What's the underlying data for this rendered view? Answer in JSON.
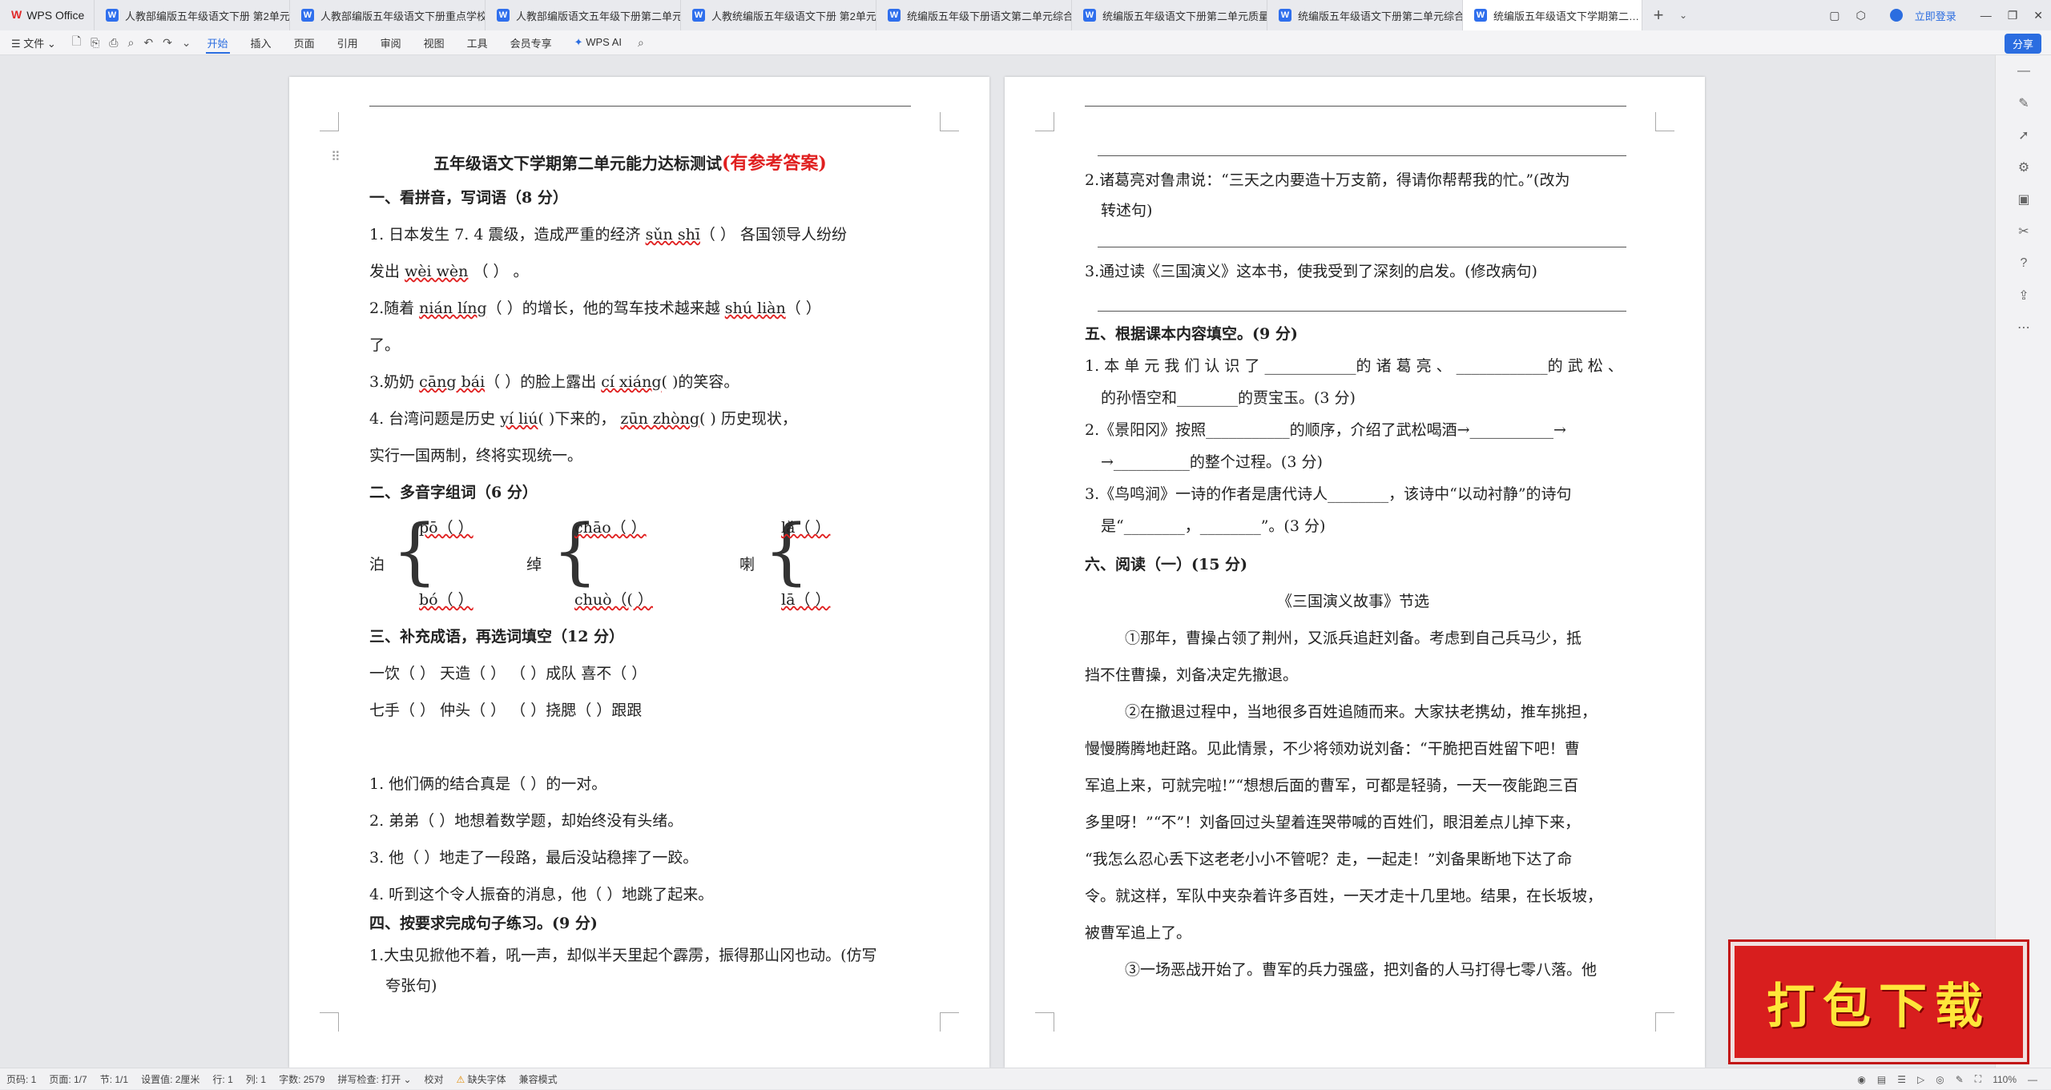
{
  "tabs": {
    "wps": "WPS Office",
    "docs": [
      "人教部编版五年级语文下册 第2单元…",
      "人教部编版五年级语文下册重点学校…",
      "人教部编版语文五年级下册第二单元…",
      "人教统编版五年级语文下册 第2单元…",
      "统编版五年级下册语文第二单元综合…",
      "统编版五年级语文下册第二单元质量…",
      "统编版五年级语文下册第二单元综合…"
    ],
    "active": "统编版五年级语文下学期第二…",
    "login": "立即登录"
  },
  "menu": {
    "file": "文件",
    "items": [
      "开始",
      "插入",
      "页面",
      "引用",
      "审阅",
      "视图",
      "工具",
      "会员专享"
    ],
    "ai": "WPS AI",
    "share": "分享"
  },
  "left": {
    "title": "五年级语文下学期第二单元能力达标测试",
    "title_red": "(有参考答案)",
    "s1": "一、看拼音，写词语（8 分）",
    "l1a": "1. 日本发生 7. 4 震级，造成严重的经济",
    "p_sunshi": "sǔn shī",
    "l1b": "（        ）  各国领导人纷纷",
    "l1c": "发出 ",
    "p_weiwen": "wèi wèn",
    "l1d": " （        ）  。",
    "l2a": "2.随着 ",
    "p_nianling": "nián líng",
    "l2b": "（        ）的增长，他的驾车技术越来越 ",
    "p_shulian": "shú liàn",
    "l2c": "（        ）",
    "l2d": "了。",
    "l3a": "3.奶奶 ",
    "p_cangbai": "cāng bái",
    "l3b": "（        ）的脸上露出  ",
    "p_cixiang": "cí xiáng",
    "l3c": "(          )的笑容。",
    "l4a": "4. 台湾问题是历史 ",
    "p_yiliu": "yí liú",
    "l4b": "(          )下来的，     ",
    "p_zunzhong": "zūn zhòng",
    "l4c": "(        )  历史现状，",
    "l4d": "实行一国两制，终将实现统一。",
    "s2": "二、多音字组词（6 分）",
    "d1": "泊",
    "d1a": "pō（        ）",
    "d1b": "bó（        ）",
    "d2": "绰",
    "d2a": "chāo（        ）",
    "d2b": "chuò（(        ）",
    "d3": "喇",
    "d3a": "lǎ（        ）",
    "d3b": "lā（        ）",
    "s3": "三、补充成语，再选词填空（12 分）",
    "i1": "一饮（      ）  天造（      ）    （      ）成队    喜不（      ）",
    "i2": "七手（      ）  仲头（      ）    （      ）挠腮（      ）跟跟",
    "q1": "1. 他们俩的结合真是（          ）的一对。",
    "q2": "2. 弟弟（          ）地想着数学题，却始终没有头绪。",
    "q3": "3. 他（            ）地走了一段路，最后没站稳摔了一跤。",
    "q4": "4. 听到这个令人振奋的消息，他（            ）地跳了起来。",
    "s4": "四、按要求完成句子练习。(9 分)",
    "r1": "1.大虫见掀他不着，吼一声，却似半天里起个霹雳，振得那山冈也动。(仿写",
    "r1b": "夸张句)"
  },
  "right": {
    "r2": "2.诸葛亮对鲁肃说：“三天之内要造十万支箭，得请你帮帮我的忙。”(改为",
    "r2b": "转述句)",
    "r3": "3.通过读《三国演义》这本书，使我受到了深刻的启发。(修改病句)",
    "s5": "五、根据课本内容填空。(9 分)",
    "f1": "1. 本 单 元 我 们 认 识 了 ____________的 诸 葛 亮 、 ____________的 武 松 、",
    "f1b": "的孙悟空和________的贾宝玉。(3 分)",
    "f2": "2.《景阳冈》按照___________的顺序，介绍了武松喝酒→___________→",
    "f2b": "→__________的整个过程。(3 分)",
    "f3": "3.《鸟鸣涧》一诗的作者是唐代诗人________，该诗中“以动衬静”的诗句",
    "f3b": "是“________，________”。(3 分)",
    "s6": "六、阅读（一）(15 分)",
    "rt": "《三国演义故事》节选",
    "p1": "①那年，曹操占领了荆州，又派兵追赶刘备。考虑到自己兵马少，抵",
    "p1b": "挡不住曹操，刘备决定先撤退。",
    "p2": "②在撤退过程中，当地很多百姓追随而来。大家扶老携幼，推车挑担，",
    "p2b": "慢慢腾腾地赶路。见此情景，不少将领劝说刘备：“干脆把百姓留下吧！曹",
    "p2c": "军追上来，可就完啦!”“想想后面的曹军，可都是轻骑，一天一夜能跑三百",
    "p2d": "多里呀！”“不”！刘备回过头望着连哭带喊的百姓们，眼泪差点儿掉下来，",
    "p2e": "“我怎么忍心丢下这老老小小不管呢？走，一起走！”刘备果断地下达了命",
    "p2f": "令。就这样，军队中夹杂着许多百姓，一天才走十几里地。结果，在长坂坡，",
    "p2g": "被曹军追上了。",
    "p3": "③一场恶战开始了。曹军的兵力强盛，把刘备的人马打得七零八落。他"
  },
  "status": {
    "page": "页码: 1",
    "pages": "页面: 1/7",
    "section": "节: 1/1",
    "setting": "设置值: 2厘米",
    "row": "行: 1",
    "col": "列: 1",
    "words": "字数: 2579",
    "spell": "拼写检查: 打开",
    "proof": "校对",
    "font": "缺失字体",
    "compat": "兼容模式",
    "zoom": "110%"
  },
  "promo": "打包下载"
}
